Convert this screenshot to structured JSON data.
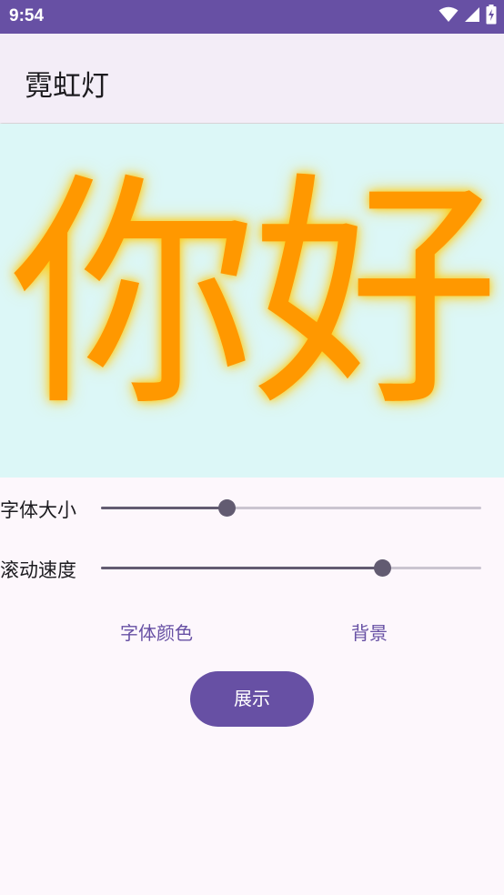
{
  "status_bar": {
    "time": "9:54",
    "icons": [
      "wifi-icon",
      "signal-icon",
      "battery-charging-icon"
    ]
  },
  "app_bar": {
    "title": "霓虹灯"
  },
  "display": {
    "text": "你好",
    "text_color": "#ff9800",
    "background_color": "#dcf7f7"
  },
  "controls": {
    "font_size": {
      "label": "字体大小",
      "value": 0.33
    },
    "scroll_speed": {
      "label": "滚动速度",
      "value": 0.74
    },
    "font_color_label": "字体颜色",
    "background_label": "背景",
    "show_label": "展示"
  },
  "colors": {
    "primary": "#6750a4",
    "slider_active": "#625b71",
    "slider_inactive": "#cac4d0",
    "app_bar_bg": "#f3edf7",
    "page_bg": "#fdf7fc"
  }
}
